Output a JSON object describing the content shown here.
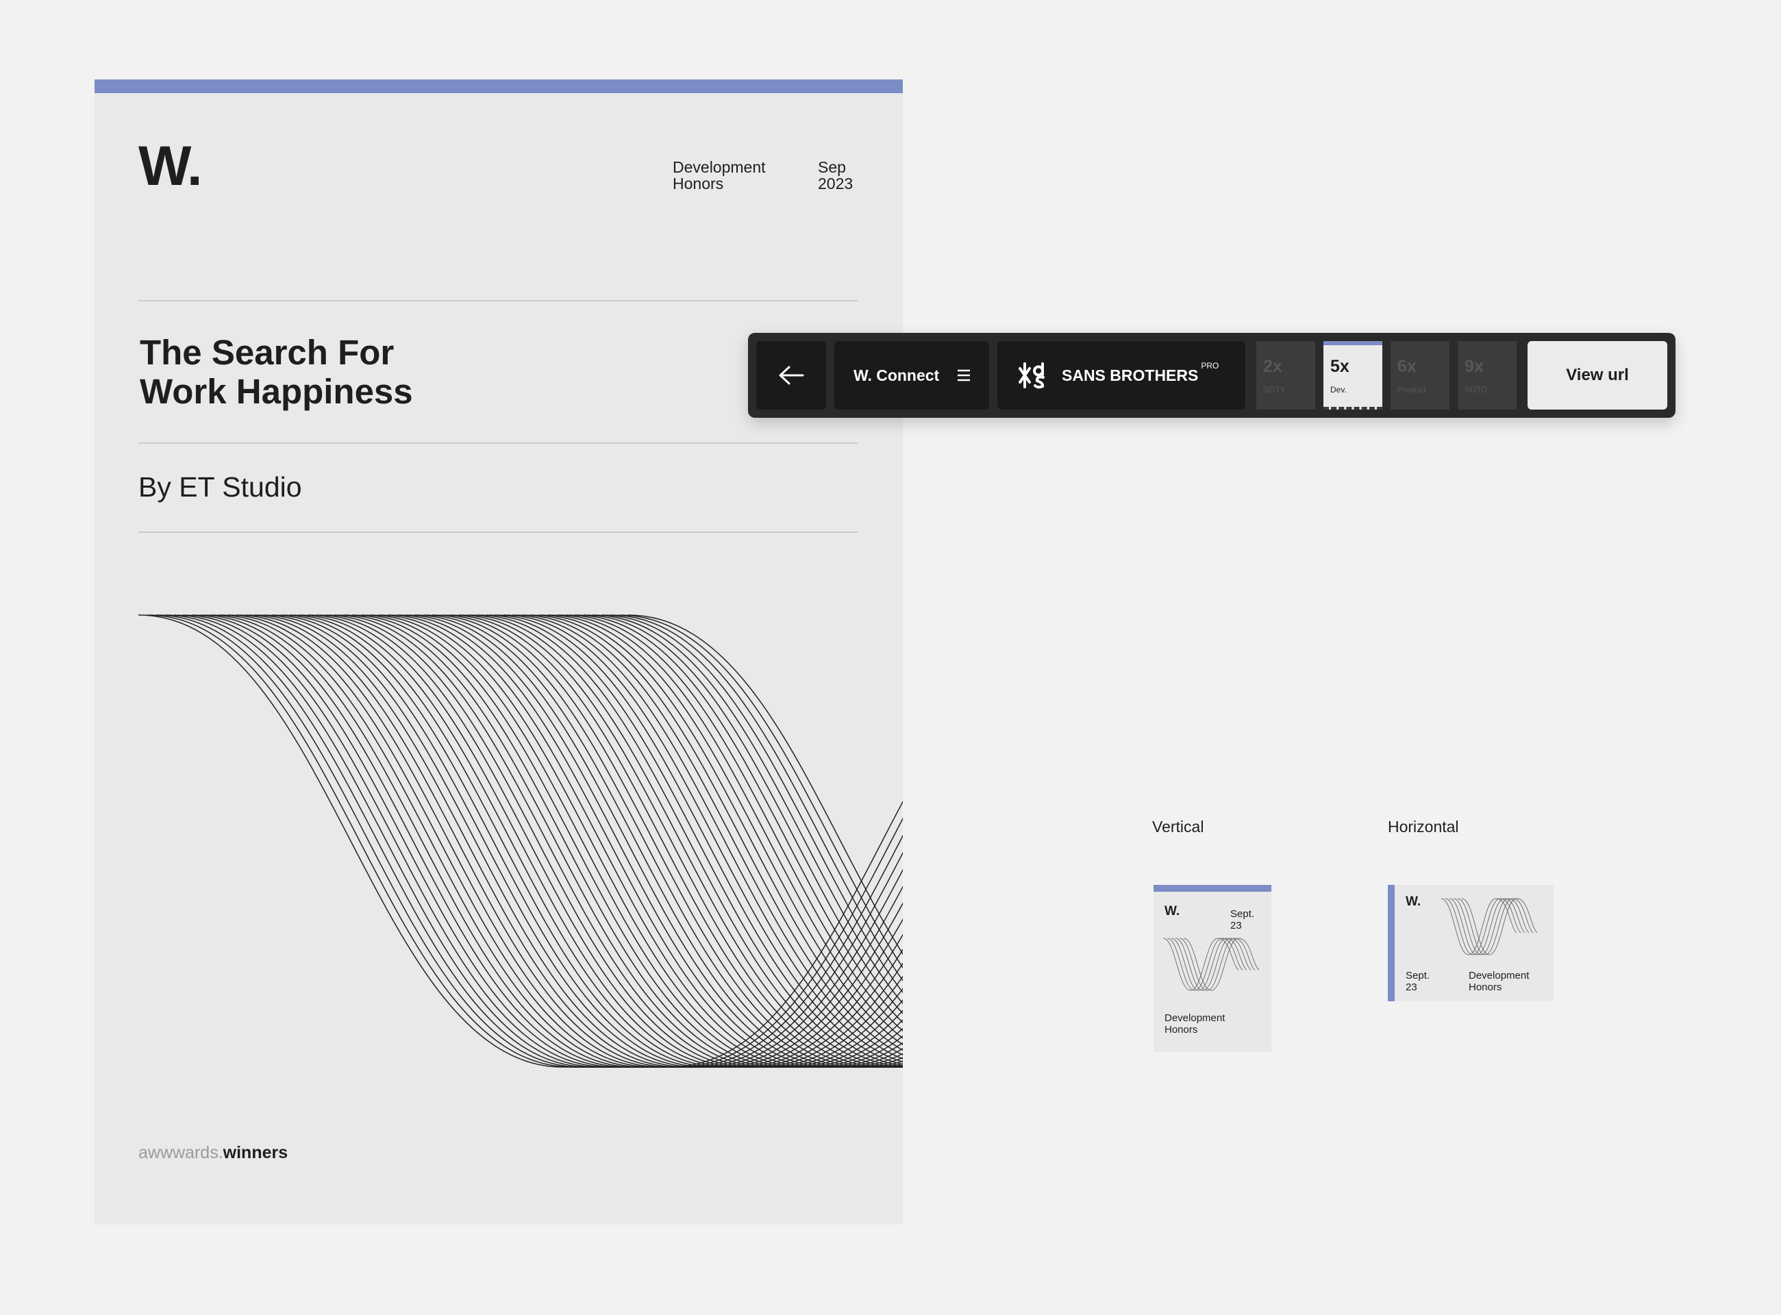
{
  "card": {
    "logo": "W.",
    "category": [
      "Development",
      "Honors"
    ],
    "date": [
      "Sep",
      "2023"
    ],
    "title": [
      "The Search For",
      "Work Happiness"
    ],
    "byline": "By ET Studio",
    "footer_light": "awwwards.",
    "footer_bold": "winners",
    "accent": "#7b8cc6"
  },
  "toolbar": {
    "back_icon": "arrow-left-icon",
    "connect_label": "W. Connect",
    "menu_icon": "hamburger-icon",
    "brand_icon": "sans-brothers-logo-icon",
    "brand_name": "SANS BROTHERS",
    "brand_tag": "PRO",
    "chips": [
      {
        "count": "2x",
        "label": "SOTY"
      },
      {
        "count": "5x",
        "label": "Dev."
      },
      {
        "count": "6x",
        "label": "Product"
      },
      {
        "count": "9x",
        "label": "SOTD"
      }
    ],
    "active_chip": 1,
    "view_url_label": "View url"
  },
  "previews": {
    "vertical_label": "Vertical",
    "horizontal_label": "Horizontal",
    "badge_logo": "W.",
    "badge_date": [
      "Sept.",
      "23"
    ],
    "badge_category": [
      "Development",
      "Honors"
    ]
  }
}
